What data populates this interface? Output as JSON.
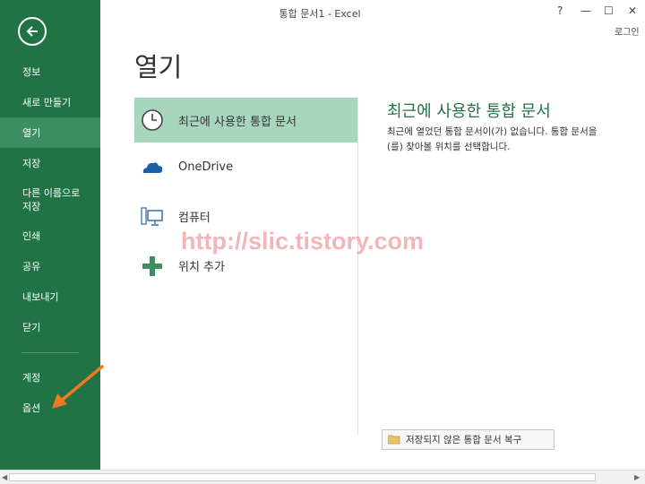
{
  "window": {
    "title": "통합 문서1 - Excel",
    "help": "?",
    "minimize": "—",
    "maximize": "☐",
    "close": "✕",
    "login": "로그인"
  },
  "sidebar": {
    "items": [
      {
        "label": "정보"
      },
      {
        "label": "새로 만들기"
      },
      {
        "label": "열기",
        "active": true
      },
      {
        "label": "저장"
      },
      {
        "label": "다른 이름으로 저장"
      },
      {
        "label": "인쇄"
      },
      {
        "label": "공유"
      },
      {
        "label": "내보내기"
      },
      {
        "label": "닫기"
      }
    ],
    "bottom_items": [
      {
        "label": "계정"
      },
      {
        "label": "옵션"
      }
    ]
  },
  "main": {
    "title": "열기",
    "places": [
      {
        "label": "최근에 사용한 통합 문서",
        "icon": "clock-icon",
        "active": true
      },
      {
        "label": "OneDrive",
        "icon": "cloud-icon"
      },
      {
        "label": "컴퓨터",
        "icon": "computer-icon"
      },
      {
        "label": "위치 추가",
        "icon": "plus-icon"
      }
    ],
    "recent": {
      "title": "최근에 사용한 통합 문서",
      "message_line1": "최근에 열었던 통합 문서이(가) 없습니다. 통합 문서을",
      "message_line2": "(를) 찾아볼 위치를 선택합니다."
    },
    "recover_button": "저장되지 않은 통합 문서 복구"
  },
  "watermark": "http://slic.tistory.com",
  "colors": {
    "brand": "#217346",
    "sidebar_active": "#3c8f60",
    "place_active": "#a7d6bd",
    "arrow": "#f07a22"
  }
}
